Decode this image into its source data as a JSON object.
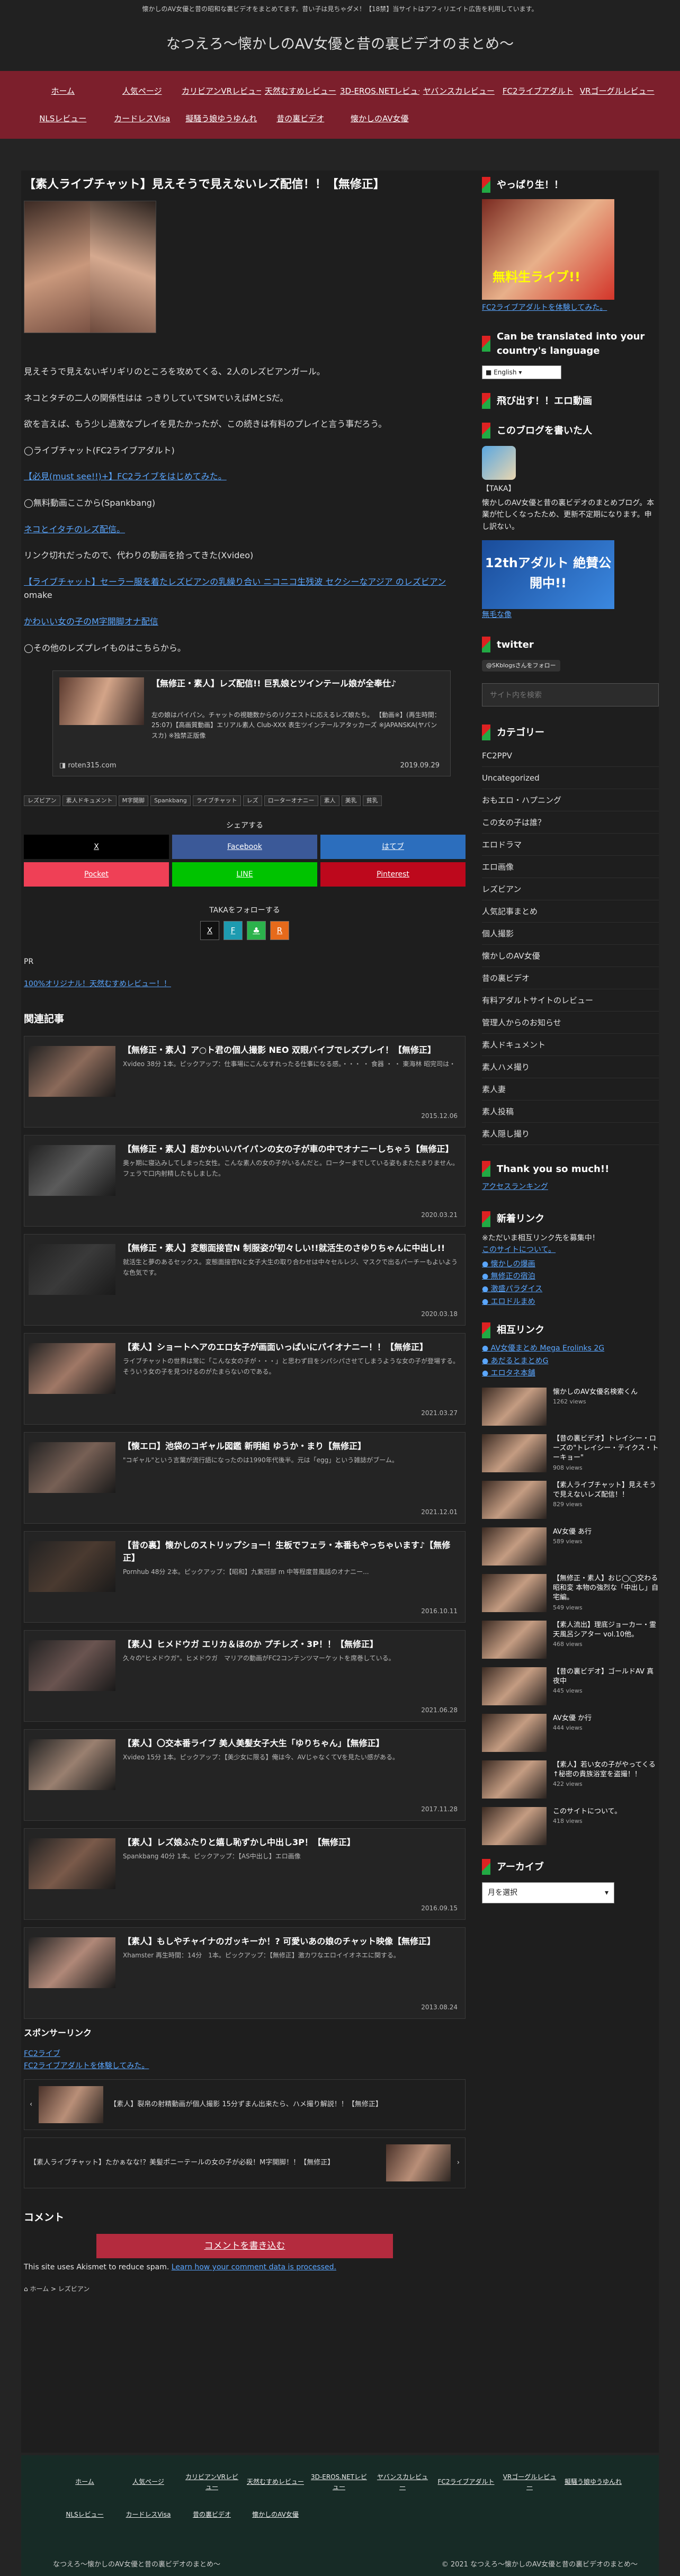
{
  "topbar": {
    "text": "懐かしのAV女優と昔の昭和な裏ビデオをまとめてます。昔い子は見ちゃダメ！【18禁】当サイトはアフィリエイト広告を利用しています。"
  },
  "header": {
    "title": "なつえろ〜懐かしのAV女優と昔の裏ビデオのまとめ〜"
  },
  "nav": [
    "ホーム",
    "人気ページ",
    "カリビアンVRレビュー",
    "天然むすめレビュー",
    "3D-EROS.NETレビュー",
    "ヤバンスカレビュー",
    "FC2ライブアダルト",
    "VRゴーグルレビュー",
    "NLSレビュー",
    "カードレスVisa",
    "擬騒う娘ゆうゆんれ",
    "昔の裏ビデオ",
    "懐かしのAV女優"
  ],
  "article": {
    "title": "【素人ライブチャット】見えそうで見えないレズ配信！！【無修正】",
    "p1": "見えそうで見えないギリギリのところを攻めてくる、2人のレズビアンガール。",
    "p2": "ネコとタチの二人の関係性はは っきりしていてSMでいえばMとSだ。",
    "p3": "欲を言えば、もう少し過激なプレイを見たかったが、この続きは有料のプレイと言う事だろう。",
    "l1": "◯ライブチャット(FC2ライブアダルト)",
    "link1": "【必見(must see!!)+】FC2ライブをはじめてみた。",
    "l2": "◯無料動画ここから(Spankbang)",
    "link2": "ネコとイタチのレズ配信。",
    "l3": "リンク切れだったので、代わりの動画を拾ってきた(Xvideo)",
    "link3": "【ライブチャット】セーラー服を着たレズビアンの乳繰り合い ニコニコ生残波 セクシーなアジア のレズビアン",
    "omake": "omake",
    "link4": "かわいい女の子のM字開脚オナ配信",
    "l4": "◯その他のレズプレイものはこちらから。",
    "bcard": {
      "title": "【無修正・素人】レズ配信!! 巨乳娘とツインテール娘が全奉仕♪",
      "summary": "左の娘はパイパン。チャットの視聴数からのリクエストに応えるレズ娘たち。 【動画※】(再生時間：25:07)【高画質動画】エリアル素人 Club-XXX 表生ツインテールアタッカーズ ※JAPANSKA(ヤバンスカ) ※独禁正版像",
      "site": "roten315.com",
      "date": "2019.09.29"
    },
    "tags": [
      "レズビアン",
      "素人ドキュメント",
      "M字開脚",
      "Spankbang",
      "ライブチャット",
      "レズ",
      "ローターオナニー",
      "素人",
      "美乳",
      "貧乳"
    ],
    "share_title": "シェアする",
    "share": [
      "X",
      "Facebook",
      "はてブ",
      "Pocket",
      "LINE",
      "Pinterest"
    ],
    "follow_title": "TAKAをフォローする",
    "follow_icons": [
      "X",
      "F",
      "♣",
      "R"
    ],
    "pr": "PR",
    "pr_link": "100%オリジナル！天然むすめレビュー！！",
    "related_title": "関連記事",
    "related": [
      {
        "title": "【無修正・素人】ア○ト君の個人撮影 NEO 双眼バイブでレズプレイ！【無修正】",
        "sum": "Xvideo 38分 1本。ピックアップ：仕事場にこんなすれったる仕事になる感。・・・ ・ 食器 ・ ・ 東海林 昭完司は・",
        "date": "2015.12.06",
        "c": "#8b6a5a"
      },
      {
        "title": "【無修正・素人】超かわいいパイパンの女の子が車の中でオナニーしちゃう【無修正】",
        "sum": "奥ヶ期に寝込みしてしまった女性。こんな素人の女の子がいるんだと。ローターまでしている姿もまたたまりません。フェラで口内射精したもしました。",
        "date": "2020.03.21",
        "c": "#5b5b5b"
      },
      {
        "title": "【無修正・素人】変態面接官N 制服姿が初々しい!!就活生のさゆりちゃんに中出し!!",
        "sum": "就活生と夢のあるセックス。変態面接官Nと女子大生の取り合わせは中々セルレジ、マスクで出るパーチーもよいような色気です。",
        "date": "2020.03.18",
        "c": "#3a3a3a"
      },
      {
        "title": "【素人】ショートヘアのエロ女子が画面いっぱいにパイオナニー！！【無修正】",
        "sum": "ライブチャットの世界は常に「こんな女の子が・・・」と思わず目をシパシパさせてしまうような女の子が登場する。そういう女の子を見つけるのがたまらないのである。",
        "date": "2021.03.27",
        "c": "#a07866"
      },
      {
        "title": "【懐エロ】池袋のコギャル図鑑 新明組 ゆうか・まり【無修正】",
        "sum": "\"コギャル\"という言葉が流行語になったのは1990年代後半。元は「egg」という雑誌がブーム。",
        "date": "2021.12.01",
        "c": "#776055"
      },
      {
        "title": "【昔の裏】懐かしのストリップショー！生板でフェラ・本番もやっちゃいます♪【無修正】",
        "sum": "Pornhub 48分 2本。ピックアップ：【昭和】九紫冠部 m 中等程度昔風話のオナニー...",
        "date": "2016.10.11",
        "c": "#4a3a30"
      },
      {
        "title": "【素人】ヒメドウガ エリカ＆ほのか プチレズ・3P！！【無修正】",
        "sum": "久々の\"ヒメドウガ\"。ヒメドウガ　マリアの動画がFC2コンテンツマーケットを席巻している。",
        "date": "2021.06.28",
        "c": "#6a5450"
      },
      {
        "title": "【素人】〇交本番ライブ 美人美髪女子大生「ゆりちゃん」【無修正】",
        "sum": "Xvideo 15分 1本。ピックアップ：【美少女に限る】俺は今、AVじゃなくてVを見たい感がある。",
        "date": "2017.11.28",
        "c": "#9a8070"
      },
      {
        "title": "【素人】レズ娘ふたりと嬉し恥ずかし中出し3P！【無修正】",
        "sum": "Spankbang 40分 1本。ピックアップ：【AS中出し】エロ画像",
        "date": "2016.09.15",
        "c": "#7a5a4a"
      },
      {
        "title": "【素人】もしやチャイナのガッキーか！? 可愛いあの娘のチャット映像【無修正】",
        "sum": "Xhamster 再生時間：14分　1本。ピックアップ：【無修正】激カワなエロイイオネエに関する。",
        "date": "2013.08.24",
        "c": "#b08878"
      }
    ],
    "sponsor_title": "スポンサーリンク",
    "sponsor_img_alt": "FC2ライブ",
    "sponsor_link": "FC2ライブアダルトを体験してみた。",
    "prev": "【素人】裂帛の射精動画が個人撮影 15分ずまん出来たら、ハメ撮り解説！！【無修正】",
    "next": "【素人ライブチャット】たかぁなな!？美髪ポニーテールの女の子が必殺！M字開脚！！【無修正】",
    "comment_title": "コメント",
    "comment_btn": "コメントを書き込む",
    "akismet": "This site uses Akismet to reduce spam.",
    "akismet_link": "Learn how your comment data is processed.",
    "breadcrumb_home": "ホーム",
    "breadcrumb_cat": "レズビアン"
  },
  "side": {
    "h1": "やっぱり生！！",
    "ad_img": "無料生ライブ!!",
    "ad_link": "FC2ライブアダルトを体験してみた。",
    "h2": "Can be translated into your country's language",
    "lang": "English",
    "h3": "飛び出す！！エロ動画",
    "h4": "このブログを書いた人",
    "author": "【TAKA】",
    "author_desc": "懐かしのAV女優と昔の裏ビデオのまとめブログ。本業が忙しくなったため、更新不定期になります。申し訳ない。",
    "promo": "12thアダルト 絶賛公開中!!",
    "promo_link": "無毛な像",
    "h5": "twitter",
    "follow_btn": "@SKblogsさんをフォロー",
    "search_placeholder": "サイト内を検索",
    "h6": "カテゴリー",
    "cats": [
      "FC2PPV",
      "Uncategorized",
      "おもエロ・ハプニング",
      "この女の子は誰？",
      "エロドラマ",
      "エロ画像",
      "レズビアン",
      "人気記事まとめ",
      "個人撮影",
      "懐かしのAV女優",
      "昔の裏ビデオ",
      "有料アダルトサイトのレビュー",
      "管理人からのお知らせ",
      "素人ドキュメント",
      "素人ハメ撮り",
      "素人妻",
      "素人投稿",
      "素人隠し撮り"
    ],
    "h7": "Thank you so much!!",
    "rank": "アクセスランキング",
    "h8": "新着リンク",
    "new_note": "※ただいま相互リンク先を募集中！",
    "new_link": "このサイトについて。",
    "new_links": [
      "懐かしの爆画",
      "無修正の宿泊",
      "激盛パラダイス",
      "エロドルまめ"
    ],
    "h9": "相互リンク",
    "mutual": [
      "AV女優まとめ Mega Erolinks 2G",
      "あだるとまとめG",
      "エロタネ本舗"
    ],
    "feed": [
      {
        "t": "懐かしのAV女優名検索くん",
        "v": "1262 views"
      },
      {
        "t": "【昔の裏ビデオ】トレイシー・ローズの\"トレイシー・テイクス・トーキョー\"",
        "v": "908 views"
      },
      {
        "t": "【素人ライブチャット】見えそうで見えないレズ配信！！",
        "v": "829 views"
      },
      {
        "t": "AV女優 あ行",
        "v": "589 views"
      },
      {
        "t": "【無修正・素人】おじ◯◯交わる 昭和変 本物の強烈な「中出し」自宅編。",
        "v": "549 views"
      },
      {
        "t": "【素人流出】理底ジョーカー・霊天風呂シアター vol.10他。",
        "v": "468 views"
      },
      {
        "t": "【昔の裏ビデオ】ゴールドAV 真夜中",
        "v": "445 views"
      },
      {
        "t": "AV女優 か行",
        "v": "444 views"
      },
      {
        "t": "【素人】若い女の子がやってくる↑秘密の貴族浴室を盗撮！！",
        "v": "422 views"
      },
      {
        "t": "このサイトについて。",
        "v": "418 views"
      }
    ],
    "h10": "アーカイブ",
    "archive": "月を選択"
  },
  "footer": {
    "nav": [
      "ホーム",
      "人気ページ",
      "カリビアンVRレビュー",
      "天然むすめレビュー",
      "3D-EROS.NETレビュー",
      "ヤバンスカレビュー",
      "FC2ライブアダルト",
      "VRゴーグルレビュー",
      "擬騒う娘ゆうゆんれ",
      "NLSレビュー",
      "カードレスVisa",
      "昔の裏ビデオ",
      "懐かしのAV女優"
    ],
    "brand": "なつえろ〜懐かしのAV女優と昔の裏ビデオのまとめ〜",
    "copy": "© 2021 なつえろ〜懐かしのAV女優と昔の裏ビデオのまとめ〜"
  },
  "colors": {
    "nav_bg": "#7c1f2c",
    "x": "#000000",
    "facebook": "#3b5998",
    "hatena": "#2c6ebd",
    "pocket": "#ef4056",
    "line": "#00c300",
    "pinterest": "#bd081c"
  }
}
